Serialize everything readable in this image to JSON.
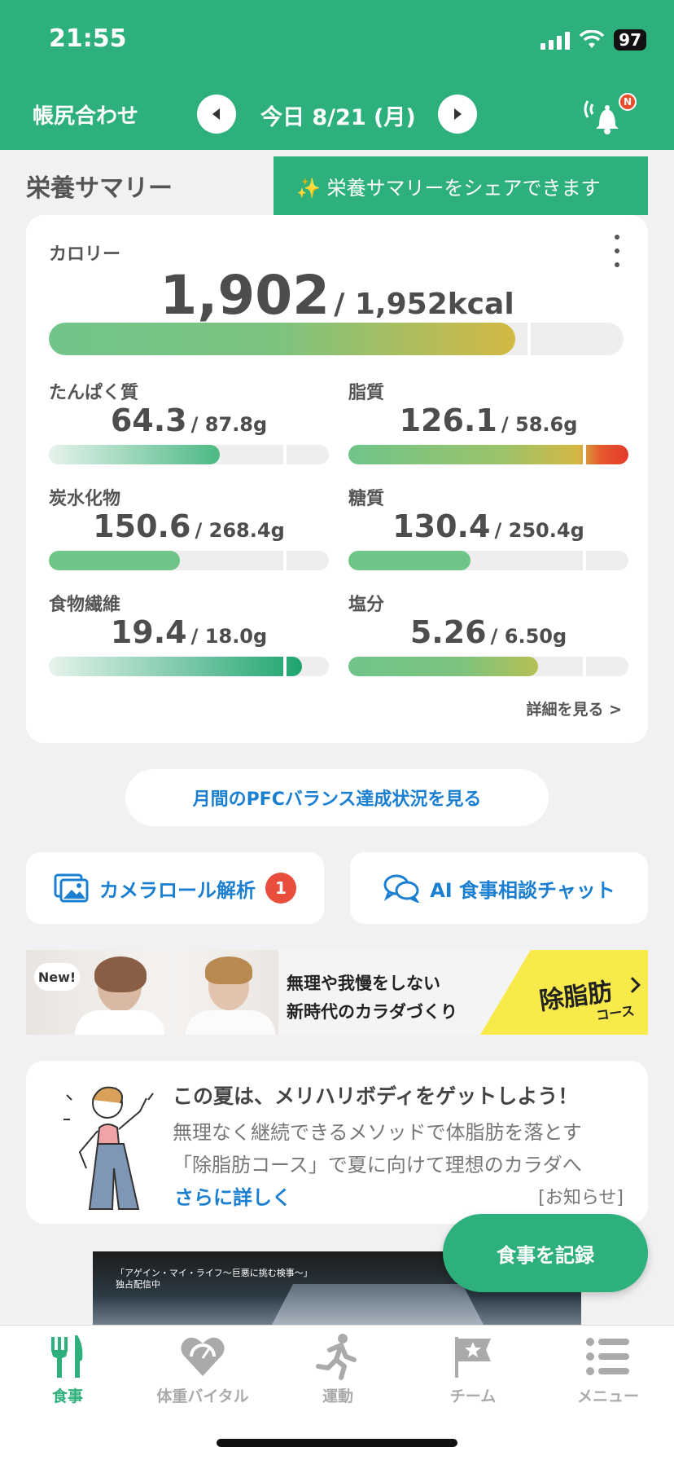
{
  "status_bar": {
    "time": "21:55",
    "battery": "97"
  },
  "header": {
    "left_label": "帳尻合わせ",
    "date_label": "今日 8/21 (月)",
    "notification_badge": "N"
  },
  "summary": {
    "title": "栄養サマリー",
    "share_tooltip": "✨ 栄養サマリーをシェアできます",
    "calorie": {
      "label": "カロリー",
      "value": "1,902",
      "goal": "/ 1,952kcal",
      "progress": 0.975
    },
    "nutrients": [
      {
        "label": "たんぱく質",
        "value": "64.3",
        "goal": "/ 87.8g",
        "progress": 0.73
      },
      {
        "label": "脂質",
        "value": "126.1",
        "goal": "/ 58.6g",
        "progress": 2.15
      },
      {
        "label": "炭水化物",
        "value": "150.6",
        "goal": "/ 268.4g",
        "progress": 0.56
      },
      {
        "label": "糖質",
        "value": "130.4",
        "goal": "/ 250.4g",
        "progress": 0.52
      },
      {
        "label": "食物繊維",
        "value": "19.4",
        "goal": "/ 18.0g",
        "progress": 1.08
      },
      {
        "label": "塩分",
        "value": "5.26",
        "goal": "/ 6.50g",
        "progress": 0.81
      }
    ],
    "detail_link": "詳細を見る >"
  },
  "pfc_button": "月間のPFCバランス達成状況を見る",
  "camera_roll": {
    "label": "カメラロール解析",
    "badge": "1"
  },
  "ai_chat": {
    "label": "AI 食事相談チャット"
  },
  "banner": {
    "new": "New!",
    "line1": "無理や我慢をしない",
    "line2": "新時代のカラダづくり",
    "cta": "除脂肪",
    "cta_sub": "コース"
  },
  "news": {
    "title": "この夏は、メリハリボディをゲットしよう！",
    "line1": "無理なく継続できるメソッドで体脂肪を落とす",
    "line2": "「除脂肪コース」で夏に向けて理想のカラダへ",
    "more": "さらに詳しく",
    "tag": "[お知らせ]"
  },
  "video": {
    "caption1": "「アゲイン・マイ・ライフ〜巨悪に挑む検事〜」",
    "caption2": "独占配信中"
  },
  "fab": "食事を記録",
  "tabs": [
    {
      "label": "食事",
      "icon": "fork-knife-icon",
      "active": true
    },
    {
      "label": "体重バイタル",
      "icon": "heart-gauge-icon",
      "active": false
    },
    {
      "label": "運動",
      "icon": "running-icon",
      "active": false
    },
    {
      "label": "チーム",
      "icon": "flag-star-icon",
      "active": false
    },
    {
      "label": "メニュー",
      "icon": "list-icon",
      "active": false
    }
  ],
  "colors": {
    "brand": "#2db07c",
    "link": "#1b7fd1",
    "badge": "#e94d3c"
  }
}
